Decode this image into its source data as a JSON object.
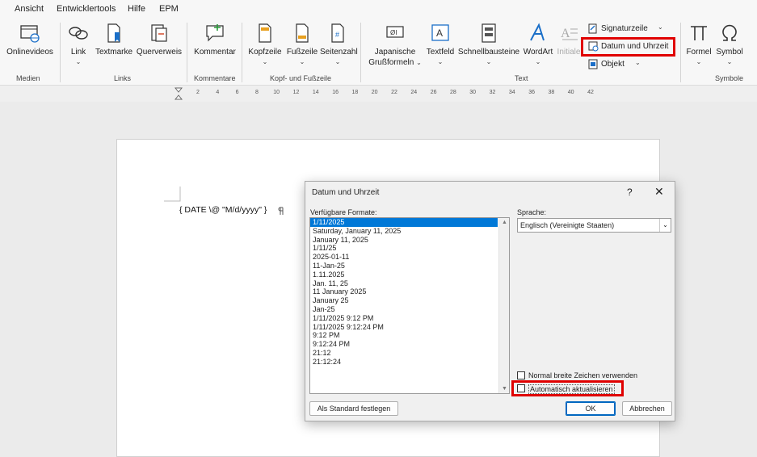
{
  "menu": {
    "items": [
      "Ansicht",
      "Entwicklertools",
      "Hilfe",
      "EPM"
    ]
  },
  "ribbon": {
    "medien": {
      "online_videos": "Onlinevideos",
      "group": "Medien"
    },
    "links": {
      "link": "Link",
      "textmarke": "Textmarke",
      "querverweis": "Querverweis",
      "group": "Links"
    },
    "kommentare": {
      "kommentar": "Kommentar",
      "group": "Kommentare"
    },
    "kopf": {
      "kopfzeile": "Kopfzeile",
      "fusszeile": "Fußzeile",
      "seitenzahl": "Seitenzahl",
      "group": "Kopf- und Fußzeile"
    },
    "text": {
      "japanische_1": "Japanische",
      "japanische_2": "Grußformeln",
      "textfeld": "Textfeld",
      "schnellbausteine": "Schnellbausteine",
      "wordart": "WordArt",
      "initiale": "Initiale",
      "signaturzeile": "Signaturzeile",
      "datum": "Datum und Uhrzeit",
      "objekt": "Objekt",
      "group": "Text"
    },
    "symbole": {
      "formel": "Formel",
      "symbol": "Symbol",
      "group": "Symbole"
    }
  },
  "ruler": {
    "ticks": [
      "2",
      "4",
      "6",
      "8",
      "10",
      "12",
      "14",
      "16",
      "18",
      "20",
      "22",
      "24",
      "26",
      "28",
      "30",
      "32",
      "34",
      "36",
      "38",
      "40",
      "42"
    ]
  },
  "document": {
    "field": "{  DATE \\@ \"M/d/yyyy\"  }"
  },
  "dialog": {
    "title": "Datum und Uhrzeit",
    "help": "?",
    "close": "✕",
    "formats_label": "Verfügbare Formate:",
    "formats": [
      "1/11/2025",
      "Saturday, January 11, 2025",
      "January 11, 2025",
      "1/11/25",
      "2025-01-11",
      "11-Jan-25",
      "1.11.2025",
      "Jan. 11, 25",
      "11 January 2025",
      "January 25",
      "Jan-25",
      "1/11/2025 9:12 PM",
      "1/11/2025 9:12:24 PM",
      "9:12 PM",
      "9:12:24 PM",
      "21:12",
      "21:12:24"
    ],
    "language_label": "Sprache:",
    "language_value": "Englisch (Vereinigte Staaten)",
    "fullwidth_label": "Normal breite Zeichen verwenden",
    "autoupdate_label": "Automatisch aktualisieren",
    "default_button": "Als Standard festlegen",
    "ok_button": "OK",
    "cancel_button": "Abbrechen"
  },
  "colors": {
    "highlight": "#e00000",
    "selection": "#0078d7",
    "accent": "#0067c0"
  }
}
